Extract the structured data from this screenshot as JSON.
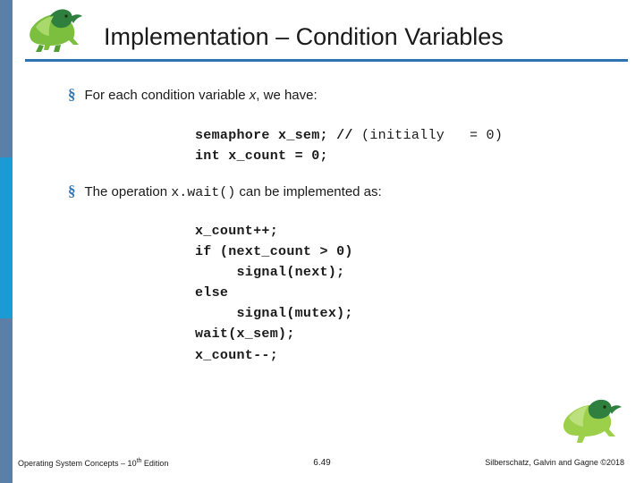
{
  "slide": {
    "title": "Implementation – Condition Variables",
    "bullets": [
      {
        "marker": "§",
        "prefix": "For each condition variable ",
        "italic_var": "x",
        "suffix": ", we  have:"
      },
      {
        "marker": "§",
        "prefix": "The operation ",
        "code": "x.wait()",
        "suffix": " can be implemented as:"
      }
    ],
    "code_blocks": [
      {
        "id": "semaphore-decl",
        "bold_part": "semaphore x_sem; //",
        "light_part": " (initially   = 0)",
        "line2": "int x_count = 0;"
      },
      {
        "id": "x-wait-impl",
        "lines": [
          "x_count++;",
          "if (next_count > 0)",
          "     signal(next);",
          "else",
          "     signal(mutex);",
          "wait(x_sem);",
          "x_count--;"
        ]
      }
    ],
    "footer": {
      "left_text": "Operating System Concepts – 10",
      "left_sup": "th",
      "left_text_end": " Edition",
      "center": "6.49",
      "right": "Silberschatz, Galvin and Gagne ©2018"
    },
    "colors": {
      "accent_rule": "#2e74b5",
      "bar_blue": "#5b7fa6",
      "bar_cyan": "#1b9ad6"
    },
    "icons": {
      "logo_top": "dinosaur-logo",
      "logo_bottom": "dinosaur-logo"
    }
  }
}
